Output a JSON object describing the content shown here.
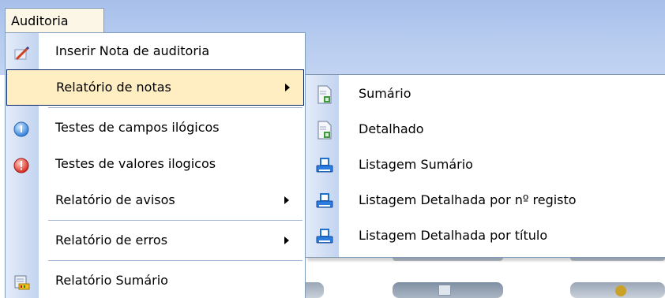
{
  "menubar": {
    "menu_title": "Auditoria"
  },
  "dropdown": {
    "items": [
      {
        "label": "Inserir Nota de auditoria",
        "icon": "note-pencil-icon"
      },
      {
        "label": "Relatório de notas",
        "icon": "",
        "has_submenu": true,
        "highlighted": true
      },
      {
        "label": "Testes de campos ilógicos",
        "icon": "info-icon"
      },
      {
        "label": "Testes de valores ilogicos",
        "icon": "error-icon"
      },
      {
        "label": "Relatório de avisos",
        "icon": "",
        "has_submenu": true
      },
      {
        "label": "Relatório de erros",
        "icon": "",
        "has_submenu": true
      },
      {
        "label": "Relatório Sumário",
        "icon": "report-summary-icon"
      }
    ]
  },
  "submenu": {
    "items": [
      {
        "label": "Sumário",
        "icon": "report-document-icon"
      },
      {
        "label": "Detalhado",
        "icon": "report-document-icon"
      },
      {
        "label": "Listagem Sumário",
        "icon": "printer-icon"
      },
      {
        "label": "Listagem Detalhada por nº registo",
        "icon": "printer-icon"
      },
      {
        "label": "Listagem Detalhada por título",
        "icon": "printer-icon"
      }
    ]
  },
  "colors": {
    "menubar_background": "#b9cdf0",
    "highlight_background": "#ffeec2",
    "highlight_border": "#0a246a",
    "gutter": "#c3d4f0",
    "menu_border": "#7f9db9"
  }
}
